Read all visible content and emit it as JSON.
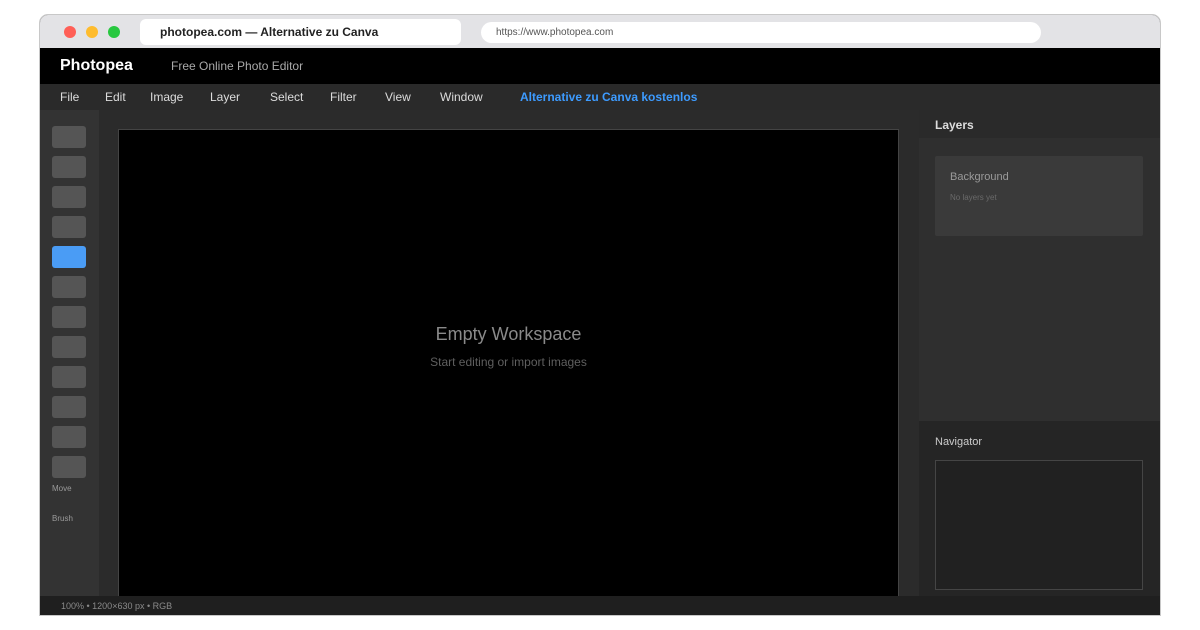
{
  "browser": {
    "tab_title": "photopea.com — Alternative zu Canva",
    "url": "https://www.photopea.com"
  },
  "header": {
    "brand": "Photopea",
    "tagline": "Free Online Photo Editor"
  },
  "menu": {
    "items": [
      {
        "label": "File"
      },
      {
        "label": "Edit"
      },
      {
        "label": "Image"
      },
      {
        "label": "Layer"
      },
      {
        "label": "Select"
      },
      {
        "label": "Filter"
      },
      {
        "label": "View"
      },
      {
        "label": "Window"
      }
    ],
    "promo": "Alternative zu Canva kostenlos",
    "promo_color": "#3d9bff"
  },
  "toolbar": {
    "tool_count": 12,
    "active_tool_index": 4,
    "active_color": "#4a9cf5",
    "labels": [
      "Move",
      "Brush"
    ]
  },
  "workspace": {
    "title": "Empty Workspace",
    "subtitle": "Start editing or import images"
  },
  "layers_panel": {
    "title": "Layers",
    "layer_name": "Background",
    "empty_text": "No layers yet"
  },
  "navigator": {
    "title": "Navigator"
  },
  "status": {
    "text": "100% • 1200×630 px • RGB"
  }
}
